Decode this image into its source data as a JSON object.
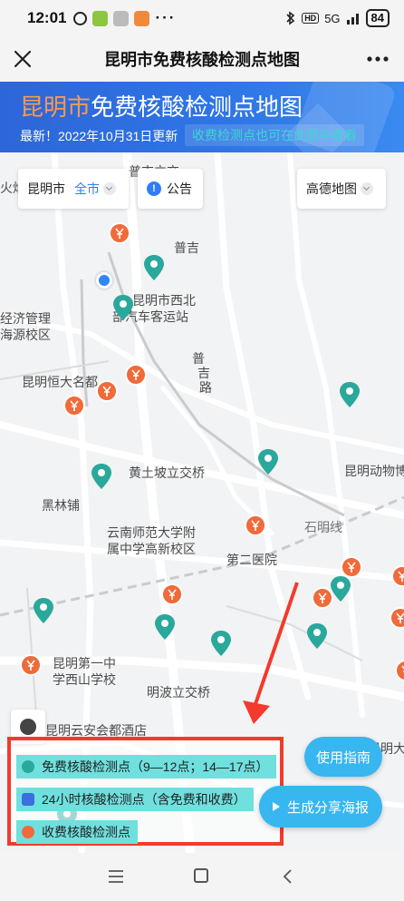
{
  "status_bar": {
    "time": "12:01",
    "network": "5G",
    "signal_text": "HD",
    "battery": "84"
  },
  "title_bar": {
    "title": "昆明市免费核酸检测点地图"
  },
  "banner": {
    "city": "昆明市",
    "headline_rest": "免费核酸检测点地图",
    "update_text": "最新！2022年10月31日更新",
    "hint": "收费检测点也可在此图中查看"
  },
  "map_controls": {
    "city_label": "昆明市",
    "district_value": "全市",
    "notice_label": "公告",
    "map_provider": "高德地图"
  },
  "places": [
    "普吉",
    "昆明市西北",
    "部汽车客运站",
    "经济管理",
    "海源校区",
    "普",
    "吉",
    "路",
    "昆明恒大名都",
    "黄土坡立交桥",
    "昆明动物博",
    "黑林铺",
    "云南师范大学附",
    "属中学高新校区",
    "石明线",
    "第二医院",
    "昆明第一中",
    "学西山学校",
    "明波立交桥",
    "昆明云安会都酒店",
    "昆明大",
    "火焰",
    "普吉立交"
  ],
  "legend": {
    "free": "免费核酸检测点（9—12点；14—17点）",
    "h24": "24小时核酸检测点（含免费和收费）",
    "paid": "收费核酸检测点"
  },
  "buttons": {
    "guide": "使用指南",
    "share": "生成分享海报"
  },
  "colors": {
    "free_pin": "#2aa89c",
    "paid_pin": "#f06a3a",
    "h24": "#3a6fe0",
    "accent": "#2f7df6",
    "highlight": "#f33a2c"
  }
}
